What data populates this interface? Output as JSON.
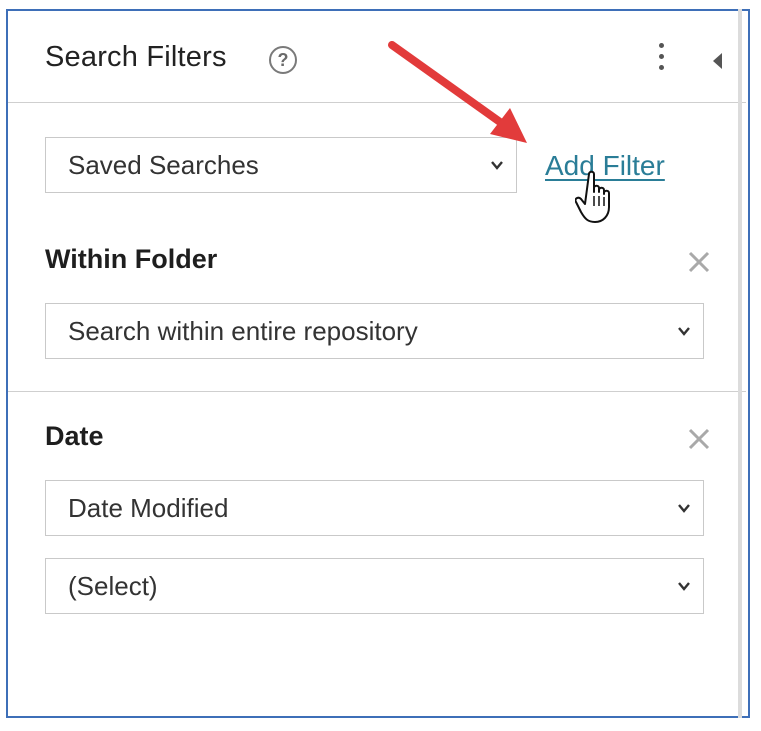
{
  "panel": {
    "title": "Search Filters",
    "help_icon": "?",
    "menu_icon": "kebab-vertical",
    "collapse_icon": "caret-left"
  },
  "saved_searches": {
    "value": "Saved Searches"
  },
  "add_filter": {
    "label": "Add Filter",
    "color": "#2a7d97"
  },
  "filters": {
    "within_folder": {
      "title": "Within Folder",
      "select_value": "Search within entire repository"
    },
    "date": {
      "title": "Date",
      "field_value": "Date Modified",
      "range_value": "(Select)"
    }
  },
  "annotation": {
    "arrow_color": "#e23b3b",
    "cursor": "hand-pointer"
  }
}
